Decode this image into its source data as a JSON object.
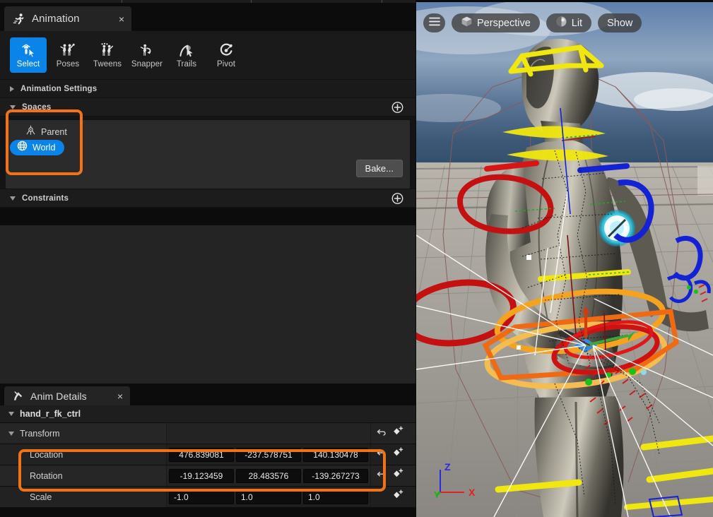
{
  "animation_panel": {
    "tab": {
      "label": "Animation",
      "icon": "running-man-icon",
      "close": "×"
    },
    "toolbar": {
      "items": [
        {
          "label": "Select",
          "icon": "select-cursor-icon",
          "active": true
        },
        {
          "label": "Poses",
          "icon": "poses-icon",
          "active": false
        },
        {
          "label": "Tweens",
          "icon": "tweens-icon",
          "active": false
        },
        {
          "label": "Snapper",
          "icon": "snapper-icon",
          "active": false
        },
        {
          "label": "Trails",
          "icon": "trails-icon",
          "active": false
        },
        {
          "label": "Pivot",
          "icon": "pivot-icon",
          "active": false
        }
      ]
    },
    "sections": {
      "animation_settings": {
        "title": "Animation Settings",
        "expanded": false
      },
      "spaces": {
        "title": "Spaces",
        "expanded": true,
        "add_label": "+",
        "items": [
          {
            "label": "Parent",
            "icon": "parent-pivot-icon",
            "selected": false
          },
          {
            "label": "World",
            "icon": "globe-icon",
            "selected": true
          }
        ],
        "bake_label": "Bake..."
      },
      "constraints": {
        "title": "Constraints",
        "expanded": true,
        "add_label": "+"
      }
    }
  },
  "anim_details": {
    "tab": {
      "label": "Anim Details",
      "icon": "anim-details-icon",
      "close": "×"
    },
    "object": {
      "name": "hand_r_fk_ctrl",
      "expanded": true
    },
    "group": {
      "name": "Transform",
      "expanded": true
    },
    "rows": [
      {
        "name": "Location",
        "values": [
          "476.839081",
          "-237.578751",
          "140.130478"
        ],
        "has_reset": true,
        "has_key": true
      },
      {
        "name": "Rotation",
        "values": [
          "-19.123459",
          "28.483576",
          "-139.267273"
        ],
        "has_reset": true,
        "has_key": true
      },
      {
        "name": "Scale",
        "values": [
          "-1.0",
          "1.0",
          "1.0"
        ],
        "has_reset": false,
        "has_key": true
      }
    ],
    "icons": {
      "reset": "undo-arrow-icon",
      "key": "add-keyframe-icon"
    }
  },
  "viewport": {
    "menu_label": "☰",
    "camera_label": "Perspective",
    "view_mode_label": "Lit",
    "show_label": "Show",
    "axis": {
      "x": "X",
      "y": "Y",
      "z": "Z"
    },
    "icons": {
      "menu": "hamburger-menu-icon",
      "camera": "cube-perspective-icon",
      "lit": "lit-sphere-icon"
    }
  },
  "annotations": {
    "accent": "#f07315",
    "highlights": [
      {
        "target": "spaces-section"
      },
      {
        "target": "location-rotation-rows"
      }
    ]
  },
  "colors": {
    "accent_blue": "#0a84e8",
    "annotation_orange": "#f07315",
    "panel_bg": "#242424",
    "header_bg": "#1c1c1c"
  }
}
